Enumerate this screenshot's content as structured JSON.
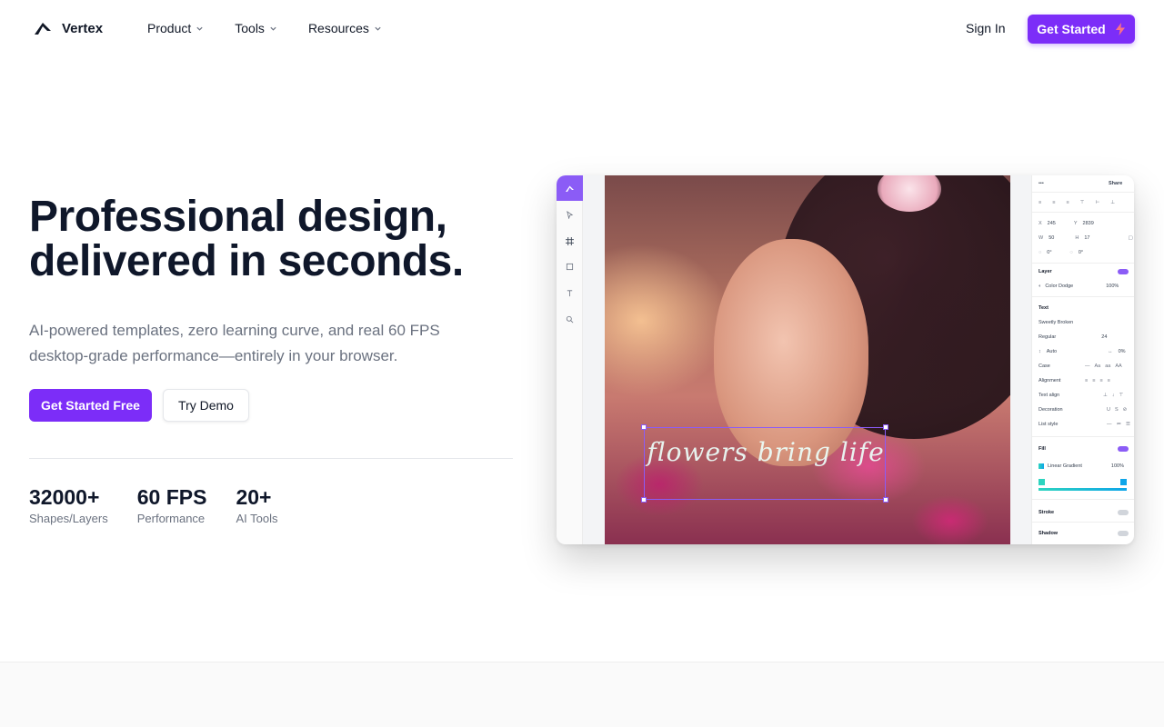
{
  "nav": {
    "brand": "Vertex",
    "menu": [
      {
        "label": "Product"
      },
      {
        "label": "Tools"
      },
      {
        "label": "Resources"
      }
    ],
    "signin": "Sign In",
    "cta": "Get Started"
  },
  "hero": {
    "title_line1": "Professional design,",
    "title_line2": "delivered in seconds.",
    "subtitle": "AI-powered templates, zero learning curve, and real 60 FPS desktop-grade performance—entirely in your browser.",
    "primary_button": "Get Started Free",
    "secondary_button": "Try Demo",
    "stats": [
      {
        "value": "32000+",
        "label": "Shapes/Layers"
      },
      {
        "value": "60 FPS",
        "label": "Performance"
      },
      {
        "value": "20+",
        "label": "AI Tools"
      }
    ]
  },
  "mockup": {
    "canvas_text": "flowers bring life",
    "panel": {
      "menu": "•••",
      "share": "Share",
      "x_label": "X",
      "x_value": "245",
      "y_label": "Y",
      "y_value": "2839",
      "w_label": "W",
      "w_value": "50",
      "h_label": "H",
      "h_value": "17",
      "rot1": "0°",
      "rot2": "0°",
      "layer_title": "Layer",
      "blend_mode": "Color Dodge",
      "layer_opacity": "100%",
      "text_title": "Text",
      "font_name": "Sweetly Broken",
      "font_weight": "Regular",
      "font_size": "24",
      "line_height": "Auto",
      "letter_spacing": "0%",
      "case_label": "Case",
      "alignment_label": "Alignment",
      "text_align_label": "Text align",
      "decoration_label": "Decoration",
      "list_style_label": "List style",
      "fill_title": "Fill",
      "fill_type": "Linear Gradient",
      "fill_opacity": "100%",
      "stroke_title": "Stroke",
      "shadow_title": "Shadow"
    }
  },
  "colors": {
    "accent": "#7c2df8",
    "panel_accent": "#8b5cf6",
    "gradient_start": "#2dd4bf",
    "gradient_end": "#0ea5e9"
  }
}
